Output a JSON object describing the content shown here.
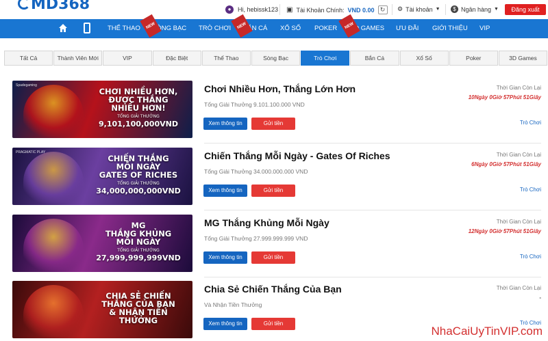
{
  "header": {
    "logo": "MD368",
    "greeting": "Hi, hebissk123",
    "main_account_label": "Tài Khoản Chính:",
    "main_account_value": "VND 0.00",
    "account_menu": "Tài khoản",
    "bank_menu": "Ngân hàng",
    "logout": "Đăng xuất"
  },
  "nav": {
    "items": [
      {
        "label": "THỂ THAO",
        "new": false
      },
      {
        "label": "SÒNG BẠC",
        "new": true
      },
      {
        "label": "TRÒ CHƠI",
        "new": false
      },
      {
        "label": "BẮN CÁ",
        "new": true
      },
      {
        "label": "XỔ SỐ",
        "new": false
      },
      {
        "label": "POKER",
        "new": false
      },
      {
        "label": "3D GAMES",
        "new": true
      },
      {
        "label": "ƯU ĐÃI",
        "new": false
      },
      {
        "label": "GIỚI THIỆU",
        "new": false
      },
      {
        "label": "VIP",
        "new": false
      }
    ],
    "new_badge": "NEW"
  },
  "tabs": [
    "Tất Cả",
    "Thành Viên Mới",
    "VIP",
    "Đặc Biệt",
    "Thể Thao",
    "Sòng Bạc",
    "Trò Chơi",
    "Bắn Cá",
    "Xổ Số",
    "Poker",
    "3D Games"
  ],
  "active_tab": "Trò Chơi",
  "promos": [
    {
      "title": "Chơi Nhiều Hơn, Thắng Lớn Hơn",
      "prize": "Tổng Giải Thưởng 9.101.100.000 VND",
      "time_label": "Thời Gian Còn Lại",
      "time_left": "10Ngày 0Giờ 57Phút 51Giây",
      "category": "Trò Chơi",
      "banner_brand": "Spadegaming",
      "banner_line1": "CHƠI NHIỀU HƠN,",
      "banner_line2": "ĐƯỢC THẮNG",
      "banner_line3": "NHIỀU HƠN!",
      "banner_sub": "TỔNG GIẢI THƯỞNG",
      "banner_amount": "9,101,100,000VND",
      "colors": [
        "#0d1e4a",
        "#b5121b",
        "#e8a020"
      ]
    },
    {
      "title": "Chiến Thắng Mỗi Ngày - Gates Of Riches",
      "prize": "Tổng Giải Thưởng 34.000.000.000 VND",
      "time_label": "Thời Gian Còn Lại",
      "time_left": "6Ngày 0Giờ 57Phút 51Giây",
      "category": "Trò Chơi",
      "banner_brand": "PRAGMATIC PLAY",
      "banner_line1": "CHIẾN THẮNG",
      "banner_line2": "MỖI NGÀY",
      "banner_line3": "GATES OF RICHES",
      "banner_sub": "TỔNG GIẢI THƯỞNG",
      "banner_amount": "34,000,000,000VND",
      "colors": [
        "#1a1240",
        "#6b3fa0",
        "#d9a441"
      ]
    },
    {
      "title": "MG Thắng Khủng Mỗi Ngày",
      "prize": "Tổng Giải Thưởng 27.999.999.999 VND",
      "time_label": "Thời Gian Còn Lại",
      "time_left": "12Ngày 0Giờ 57Phút 51Giây",
      "category": "Trò Chơi",
      "banner_brand": "",
      "banner_line1": "MG",
      "banner_line2": "THẮNG KHỦNG",
      "banner_line3": "MỖI NGÀY",
      "banner_sub": "TỔNG GIẢI THƯỞNG",
      "banner_amount": "27,999,999,999VND",
      "colors": [
        "#1b0b3a",
        "#8a2a8a",
        "#e0b040"
      ]
    },
    {
      "title": "Chia Sẻ Chiến Thắng Của Bạn",
      "prize": "Và Nhận Tiền Thưởng",
      "time_label": "Thời Gian Còn Lại",
      "time_left": "-",
      "category": "Trò Chơi",
      "banner_brand": "",
      "banner_line1": "CHIA SẺ CHIẾN",
      "banner_line2": "THẮNG CỦA BẠN",
      "banner_line3": "& NHẬN TIỀN THƯỞNG",
      "banner_sub": "",
      "banner_amount": "",
      "colors": [
        "#3a0a0a",
        "#b32020",
        "#f07a30"
      ]
    }
  ],
  "buttons": {
    "info": "Xem thông tin",
    "send": "Gửi tiền"
  },
  "watermark": "NhaCaiUyTinVIP.com"
}
